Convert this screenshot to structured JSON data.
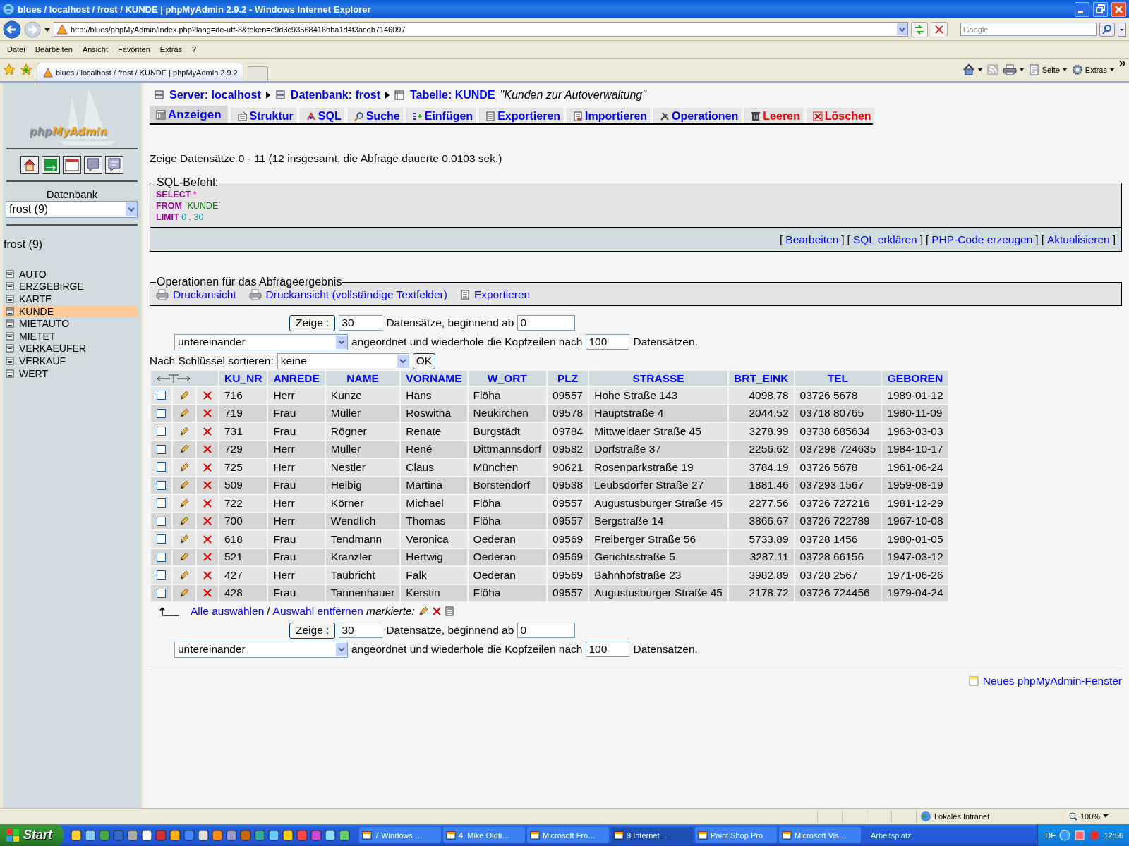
{
  "window": {
    "title": "blues / localhost / frost / KUNDE | phpMyAdmin 2.9.2 - Windows Internet Explorer"
  },
  "address_bar": {
    "url": "http://blues/phpMyAdmin/index.php?lang=de-utf-8&token=c9d3c93568416bba1d4f3aceb7146097",
    "search_placeholder": "Google"
  },
  "menu": [
    "Datei",
    "Bearbeiten",
    "Ansicht",
    "Favoriten",
    "Extras",
    "?"
  ],
  "browser_tabs": [
    {
      "label": "blues / localhost / frost / KUNDE | phpMyAdmin 2.9.2",
      "selected": true
    }
  ],
  "command_bar": [
    "Seite",
    "Extras"
  ],
  "sidebar": {
    "logo": [
      "php",
      "MyAdmin"
    ],
    "database_label": "Datenbank",
    "database_select": "frost (9)",
    "db_heading": "frost (9)",
    "tables": [
      {
        "label": "AUTO",
        "selected": false
      },
      {
        "label": "ERZGEBIRGE",
        "selected": false
      },
      {
        "label": "KARTE",
        "selected": false
      },
      {
        "label": "KUNDE",
        "selected": true
      },
      {
        "label": "MIETAUTO",
        "selected": false
      },
      {
        "label": "MIETET",
        "selected": false
      },
      {
        "label": "VERKAEUFER",
        "selected": false
      },
      {
        "label": "VERKAUF",
        "selected": false
      },
      {
        "label": "WERT",
        "selected": false
      }
    ]
  },
  "breadcrumb": [
    "Server: localhost",
    "Datenbank: frost",
    "Tabelle: KUNDE"
  ],
  "table_comment": "\"Kunden zur Autoverwaltung\"",
  "tabs": [
    {
      "label": "Anzeigen",
      "selected": true,
      "kind": "normal"
    },
    {
      "label": "Struktur",
      "selected": false,
      "kind": "normal"
    },
    {
      "label": "SQL",
      "selected": false,
      "kind": "normal"
    },
    {
      "label": "Suche",
      "selected": false,
      "kind": "normal"
    },
    {
      "label": "Einfügen",
      "selected": false,
      "kind": "normal"
    },
    {
      "label": "Exportieren",
      "selected": false,
      "kind": "normal"
    },
    {
      "label": "Importieren",
      "selected": false,
      "kind": "normal"
    },
    {
      "label": "Operationen",
      "selected": false,
      "kind": "normal"
    },
    {
      "label": "Leeren",
      "selected": false,
      "kind": "danger"
    },
    {
      "label": "Löschen",
      "selected": false,
      "kind": "danger"
    }
  ],
  "summary": "Zeige Datensätze 0 - 11 (12 insgesamt, die Abfrage dauerte 0.0103 sek.)",
  "sql_box": {
    "legend": "SQL-Befehl:",
    "lines": [
      [
        {
          "text": "SELECT",
          "kind": "keyword"
        },
        {
          "text": "*",
          "kind": "operator"
        }
      ],
      [
        {
          "text": "FROM",
          "kind": "keyword"
        },
        {
          "text": "`KUNDE`",
          "kind": "identifier"
        }
      ],
      [
        {
          "text": "LIMIT",
          "kind": "keyword"
        },
        {
          "text": "0 , 30",
          "kind": "number"
        }
      ]
    ],
    "links": [
      {
        "open": "[",
        "label": "Bearbeiten",
        "close": "]"
      },
      {
        "open": "[",
        "label": "SQL erklären",
        "close": "]"
      },
      {
        "open": "[",
        "label": "PHP-Code erzeugen",
        "close": "]"
      },
      {
        "open": "[",
        "label": "Aktualisieren",
        "close": "]"
      }
    ]
  },
  "operations": {
    "legend": "Operationen für das Abfrageergebnis",
    "links": [
      "Druckansicht",
      "Druckansicht (vollständige Textfelder)",
      "Exportieren"
    ]
  },
  "navigation": [
    {
      "button": "Zeige :",
      "rows": "30",
      "text_start": "Datensätze, beginnend ab",
      "start": "0",
      "mode": "untereinander",
      "text_repeat": "angeordnet und wiederhole die Kopfzeilen nach",
      "repeat": "100",
      "text_end": "Datensätzen."
    },
    {
      "button": "Zeige :",
      "rows": "30",
      "text_start": "Datensätze, beginnend ab",
      "start": "0",
      "mode": "untereinander",
      "text_repeat": "angeordnet und wiederhole die Kopfzeilen nach",
      "repeat": "100",
      "text_end": "Datensätzen."
    }
  ],
  "sort": {
    "label": "Nach Schlüssel sortieren:",
    "value": "keine",
    "button": "OK"
  },
  "table": {
    "columns": [
      {
        "label": "KU_NR",
        "kind": "text"
      },
      {
        "label": "ANREDE",
        "kind": "text"
      },
      {
        "label": "NAME",
        "kind": "text"
      },
      {
        "label": "VORNAME",
        "kind": "text"
      },
      {
        "label": "W_ORT",
        "kind": "text"
      },
      {
        "label": "PLZ",
        "kind": "text"
      },
      {
        "label": "STRASSE",
        "kind": "text"
      },
      {
        "label": "BRT_EINK",
        "kind": "decimal"
      },
      {
        "label": "TEL",
        "kind": "text"
      },
      {
        "label": "GEBOREN",
        "kind": "text"
      }
    ],
    "rows": [
      {
        "checked": false,
        "cells": [
          "716",
          "Herr",
          "Kunze",
          "Hans",
          "Flöha",
          "09557",
          "Hohe Straße 143",
          "4098.78",
          "03726 5678",
          "1989-01-12"
        ]
      },
      {
        "checked": false,
        "cells": [
          "719",
          "Frau",
          "Müller",
          "Roswitha",
          "Neukirchen",
          "09578",
          "Hauptstraße 4",
          "2044.52",
          "03718 80765",
          "1980-11-09"
        ]
      },
      {
        "checked": false,
        "cells": [
          "731",
          "Frau",
          "Rögner",
          "Renate",
          "Burgstädt",
          "09784",
          "Mittweidaer Straße 45",
          "3278.99",
          "03738 685634",
          "1963-03-03"
        ]
      },
      {
        "checked": false,
        "cells": [
          "729",
          "Herr",
          "Müller",
          "René",
          "Dittmannsdorf",
          "09582",
          "Dorfstraße 37",
          "2256.62",
          "037298 724635",
          "1984-10-17"
        ]
      },
      {
        "checked": false,
        "cells": [
          "725",
          "Herr",
          "Nestler",
          "Claus",
          "München",
          "90621",
          "Rosenparkstraße 19",
          "3784.19",
          "03726 5678",
          "1961-06-24"
        ]
      },
      {
        "checked": false,
        "cells": [
          "509",
          "Frau",
          "Helbig",
          "Martina",
          "Borstendorf",
          "09538",
          "Leubsdorfer Straße 27",
          "1881.46",
          "037293 1567",
          "1959-08-19"
        ]
      },
      {
        "checked": false,
        "cells": [
          "722",
          "Herr",
          "Körner",
          "Michael",
          "Flöha",
          "09557",
          "Augustusburger Straße 45",
          "2277.56",
          "03726 727216",
          "1981-12-29"
        ]
      },
      {
        "checked": false,
        "cells": [
          "700",
          "Herr",
          "Wendlich",
          "Thomas",
          "Flöha",
          "09557",
          "Bergstraße 14",
          "3866.67",
          "03726 722789",
          "1967-10-08"
        ]
      },
      {
        "checked": false,
        "cells": [
          "618",
          "Frau",
          "Tendmann",
          "Veronica",
          "Oederan",
          "09569",
          "Freiberger Straße 56",
          "5733.89",
          "03728 1456",
          "1980-01-05"
        ]
      },
      {
        "checked": false,
        "cells": [
          "521",
          "Frau",
          "Kranzler",
          "Hertwig",
          "Oederan",
          "09569",
          "Gerichtsstraße 5",
          "3287.11",
          "03728 66156",
          "1947-03-12"
        ]
      },
      {
        "checked": false,
        "cells": [
          "427",
          "Herr",
          "Taubricht",
          "Falk",
          "Oederan",
          "09569",
          "Bahnhofstraße 23",
          "3982.89",
          "03728 2567",
          "1971-06-26"
        ]
      },
      {
        "checked": false,
        "cells": [
          "428",
          "Frau",
          "Tannenhauer",
          "Kerstin",
          "Flöha",
          "09557",
          "Augustusburger Straße 45",
          "2178.72",
          "03726 724456",
          "1979-04-24"
        ]
      }
    ]
  },
  "bulk": {
    "select_all": "Alle auswählen",
    "separator": "/",
    "deselect": "Auswahl entfernen",
    "marked": "markierte:"
  },
  "new_window_link": "Neues phpMyAdmin-Fenster",
  "status_bar": {
    "zone": "Lokales Intranet",
    "zoom": "100%"
  },
  "taskbar": {
    "start": "Start",
    "tasks": [
      {
        "label": "7 Windows …",
        "selected": false
      },
      {
        "label": "4. Mike Oldfi…",
        "selected": false
      },
      {
        "label": "Microsoft Fro…",
        "selected": false
      },
      {
        "label": "9 Internet …",
        "selected": true
      },
      {
        "label": "Paint Shop Pro",
        "selected": false
      },
      {
        "label": "Microsoft Vis…",
        "selected": false
      }
    ],
    "toolbar_label": "Arbeitsplatz",
    "language": "DE",
    "clock": "12:56"
  }
}
